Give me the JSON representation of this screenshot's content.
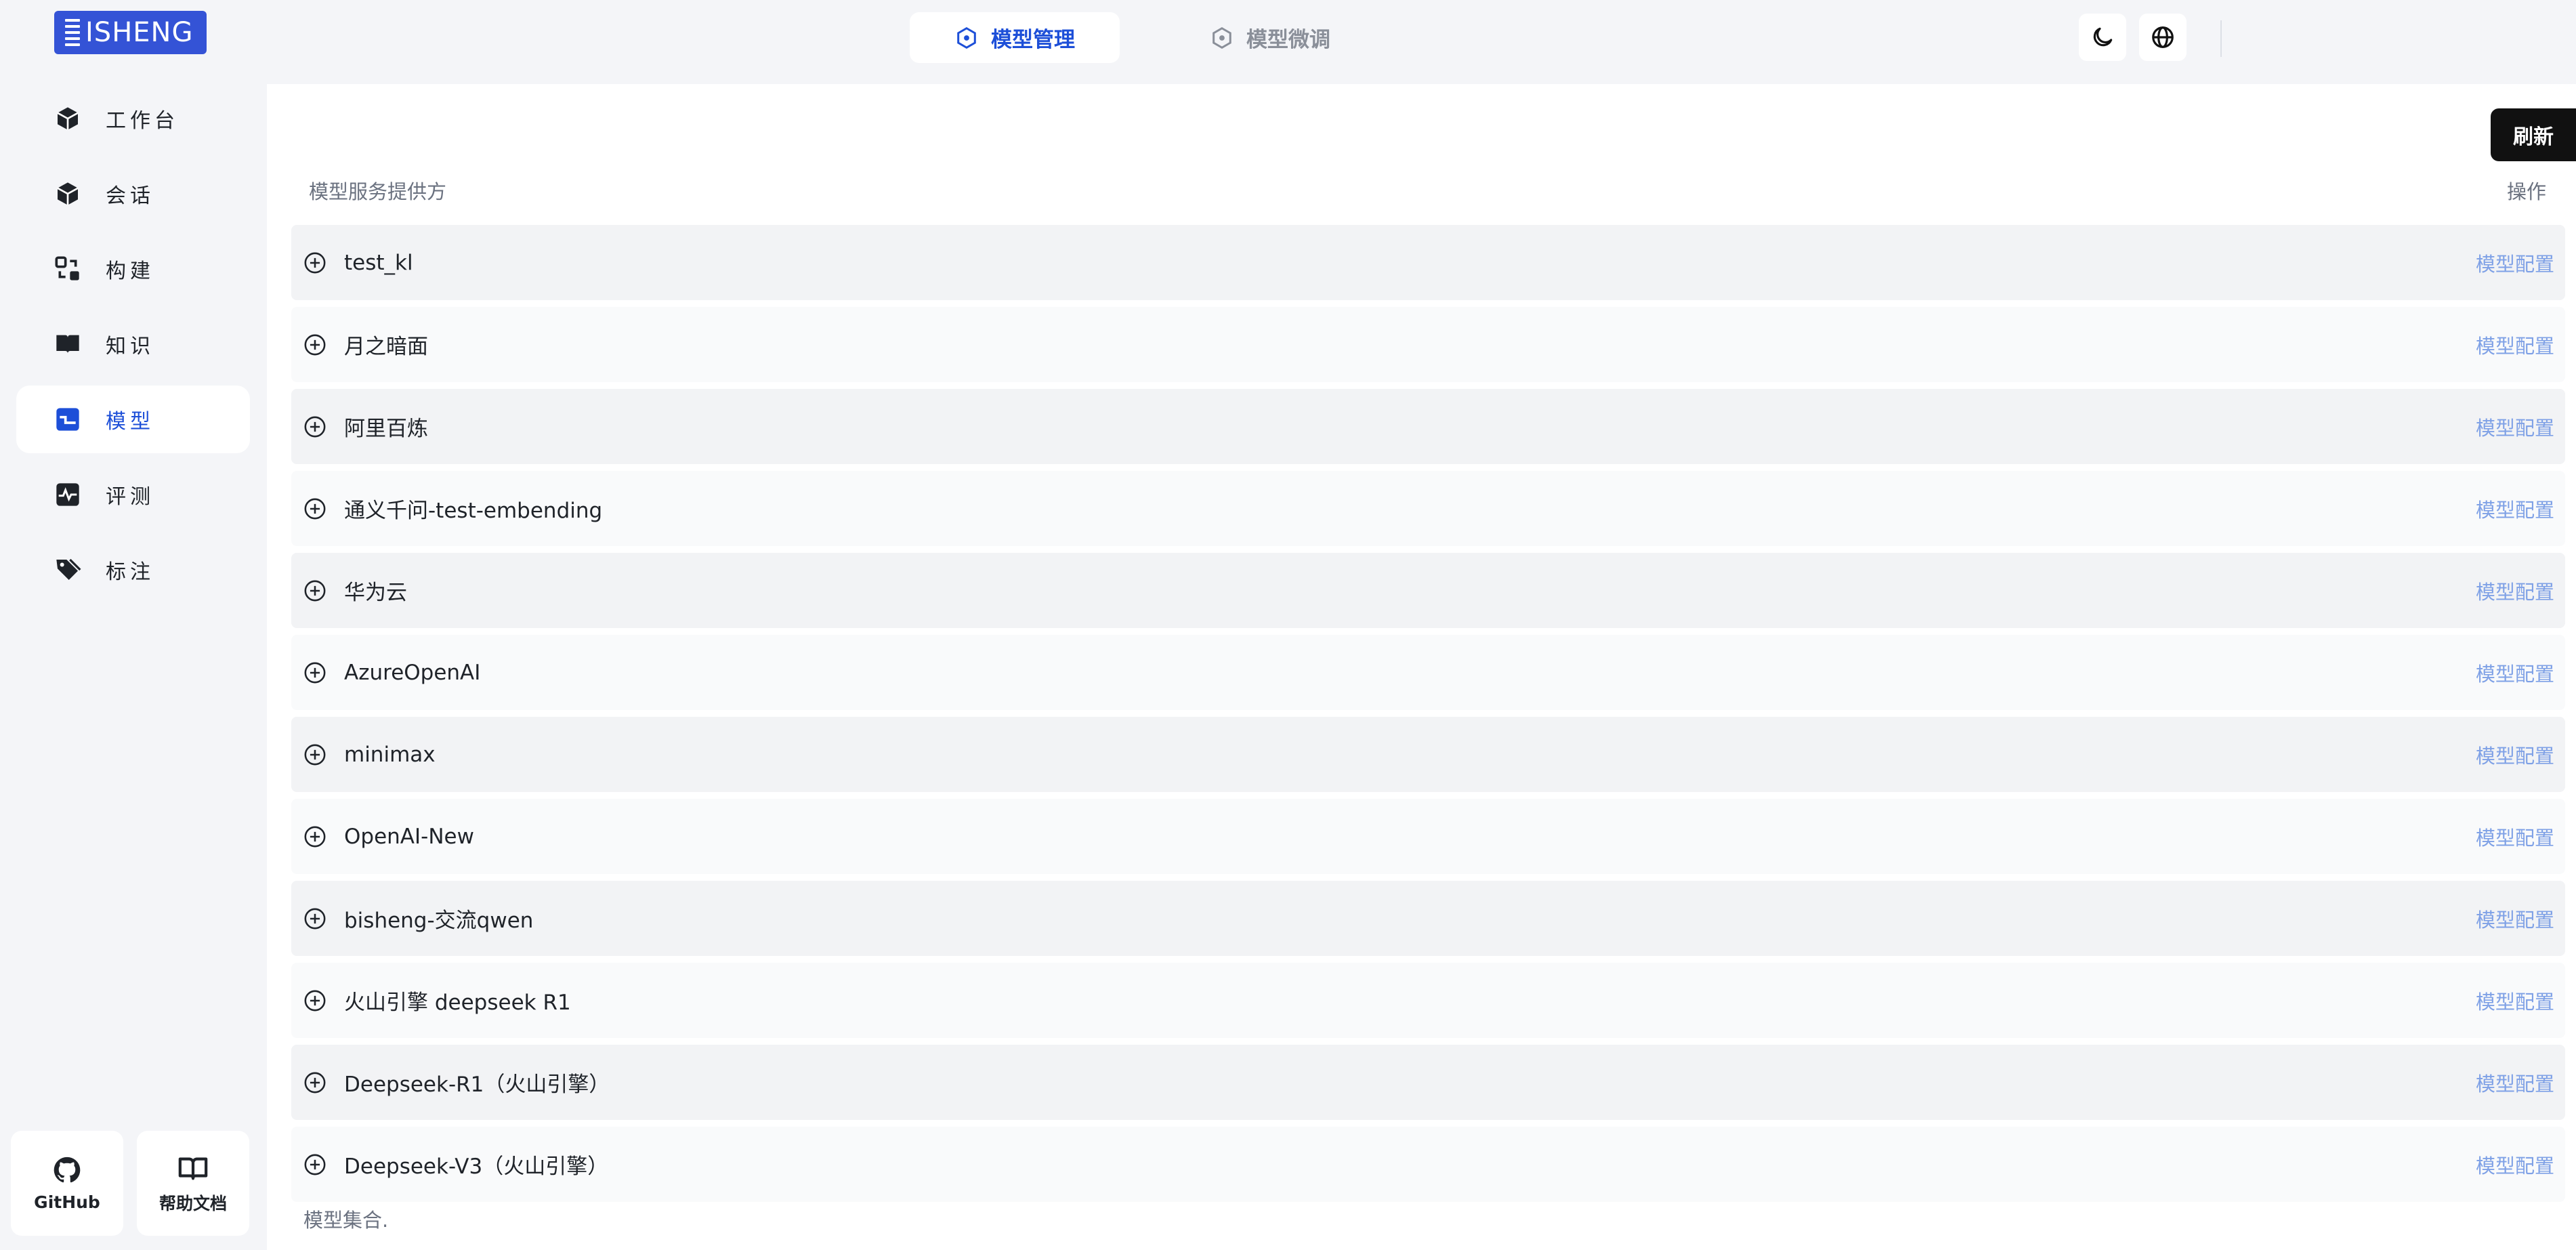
{
  "brand": {
    "logo_text": "ISHENG",
    "accent": "#3453d6"
  },
  "header": {
    "tabs": [
      {
        "label": "模型管理",
        "icon": "hexagon-icon",
        "active": true
      },
      {
        "label": "模型微调",
        "icon": "hexagon-icon",
        "active": false
      }
    ],
    "icons": [
      "moon-icon",
      "globe-icon"
    ]
  },
  "sidebar": {
    "items": [
      {
        "label": "工作台",
        "icon": "cube-icon"
      },
      {
        "label": "会话",
        "icon": "cube-icon"
      },
      {
        "label": "构建",
        "icon": "build-icon"
      },
      {
        "label": "知识",
        "icon": "book-icon"
      },
      {
        "label": "模型",
        "icon": "model-icon",
        "active": true
      },
      {
        "label": "评测",
        "icon": "chart-icon"
      },
      {
        "label": "标注",
        "icon": "tag-icon"
      }
    ],
    "bottom": [
      {
        "label": "GitHub",
        "icon": "github-icon"
      },
      {
        "label": "帮助文档",
        "icon": "book-open-icon"
      }
    ]
  },
  "main": {
    "refresh_label": "刷新",
    "col_provider": "模型服务提供方",
    "col_action": "操作",
    "action_label": "模型配置",
    "providers": [
      "test_kl",
      "月之暗面",
      "阿里百炼",
      "通义千问-test-embending",
      "华为云",
      "AzureOpenAI",
      "minimax",
      "OpenAI-New",
      "bisheng-交流qwen",
      "火山引擎 deepseek R1",
      "Deepseek-R1（火山引擎）",
      "Deepseek-V3（火山引擎）"
    ],
    "footer": "模型集合."
  }
}
